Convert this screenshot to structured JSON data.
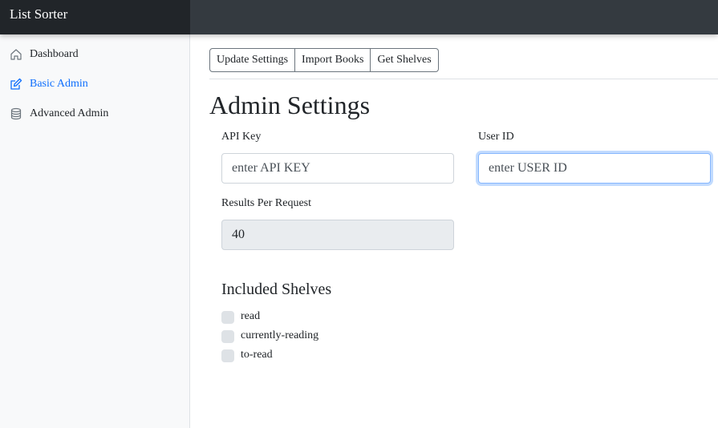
{
  "app": {
    "brand": "List Sorter"
  },
  "sidebar": {
    "items": [
      {
        "label": "Dashboard",
        "icon": "home-icon",
        "active": false
      },
      {
        "label": "Basic Admin",
        "icon": "edit-icon",
        "active": true
      },
      {
        "label": "Advanced Admin",
        "icon": "database-icon",
        "active": false
      }
    ]
  },
  "toolbar": {
    "update_settings": "Update Settings",
    "import_books": "Import Books",
    "get_shelves": "Get Shelves"
  },
  "main": {
    "title": "Admin Settings",
    "api_key": {
      "label": "API Key",
      "placeholder": "enter API KEY",
      "value": ""
    },
    "user_id": {
      "label": "User ID",
      "placeholder": "enter USER ID",
      "value": ""
    },
    "results_per_request": {
      "label": "Results Per Request",
      "value": "40"
    },
    "shelves": {
      "title": "Included Shelves",
      "items": [
        {
          "label": "read",
          "checked": false
        },
        {
          "label": "currently-reading",
          "checked": false
        },
        {
          "label": "to-read",
          "checked": false
        }
      ]
    }
  },
  "colors": {
    "topbar": "#343a40",
    "brand_bg": "#212529",
    "accent": "#0d6efd",
    "sidebar_bg": "#f8f9fa"
  }
}
